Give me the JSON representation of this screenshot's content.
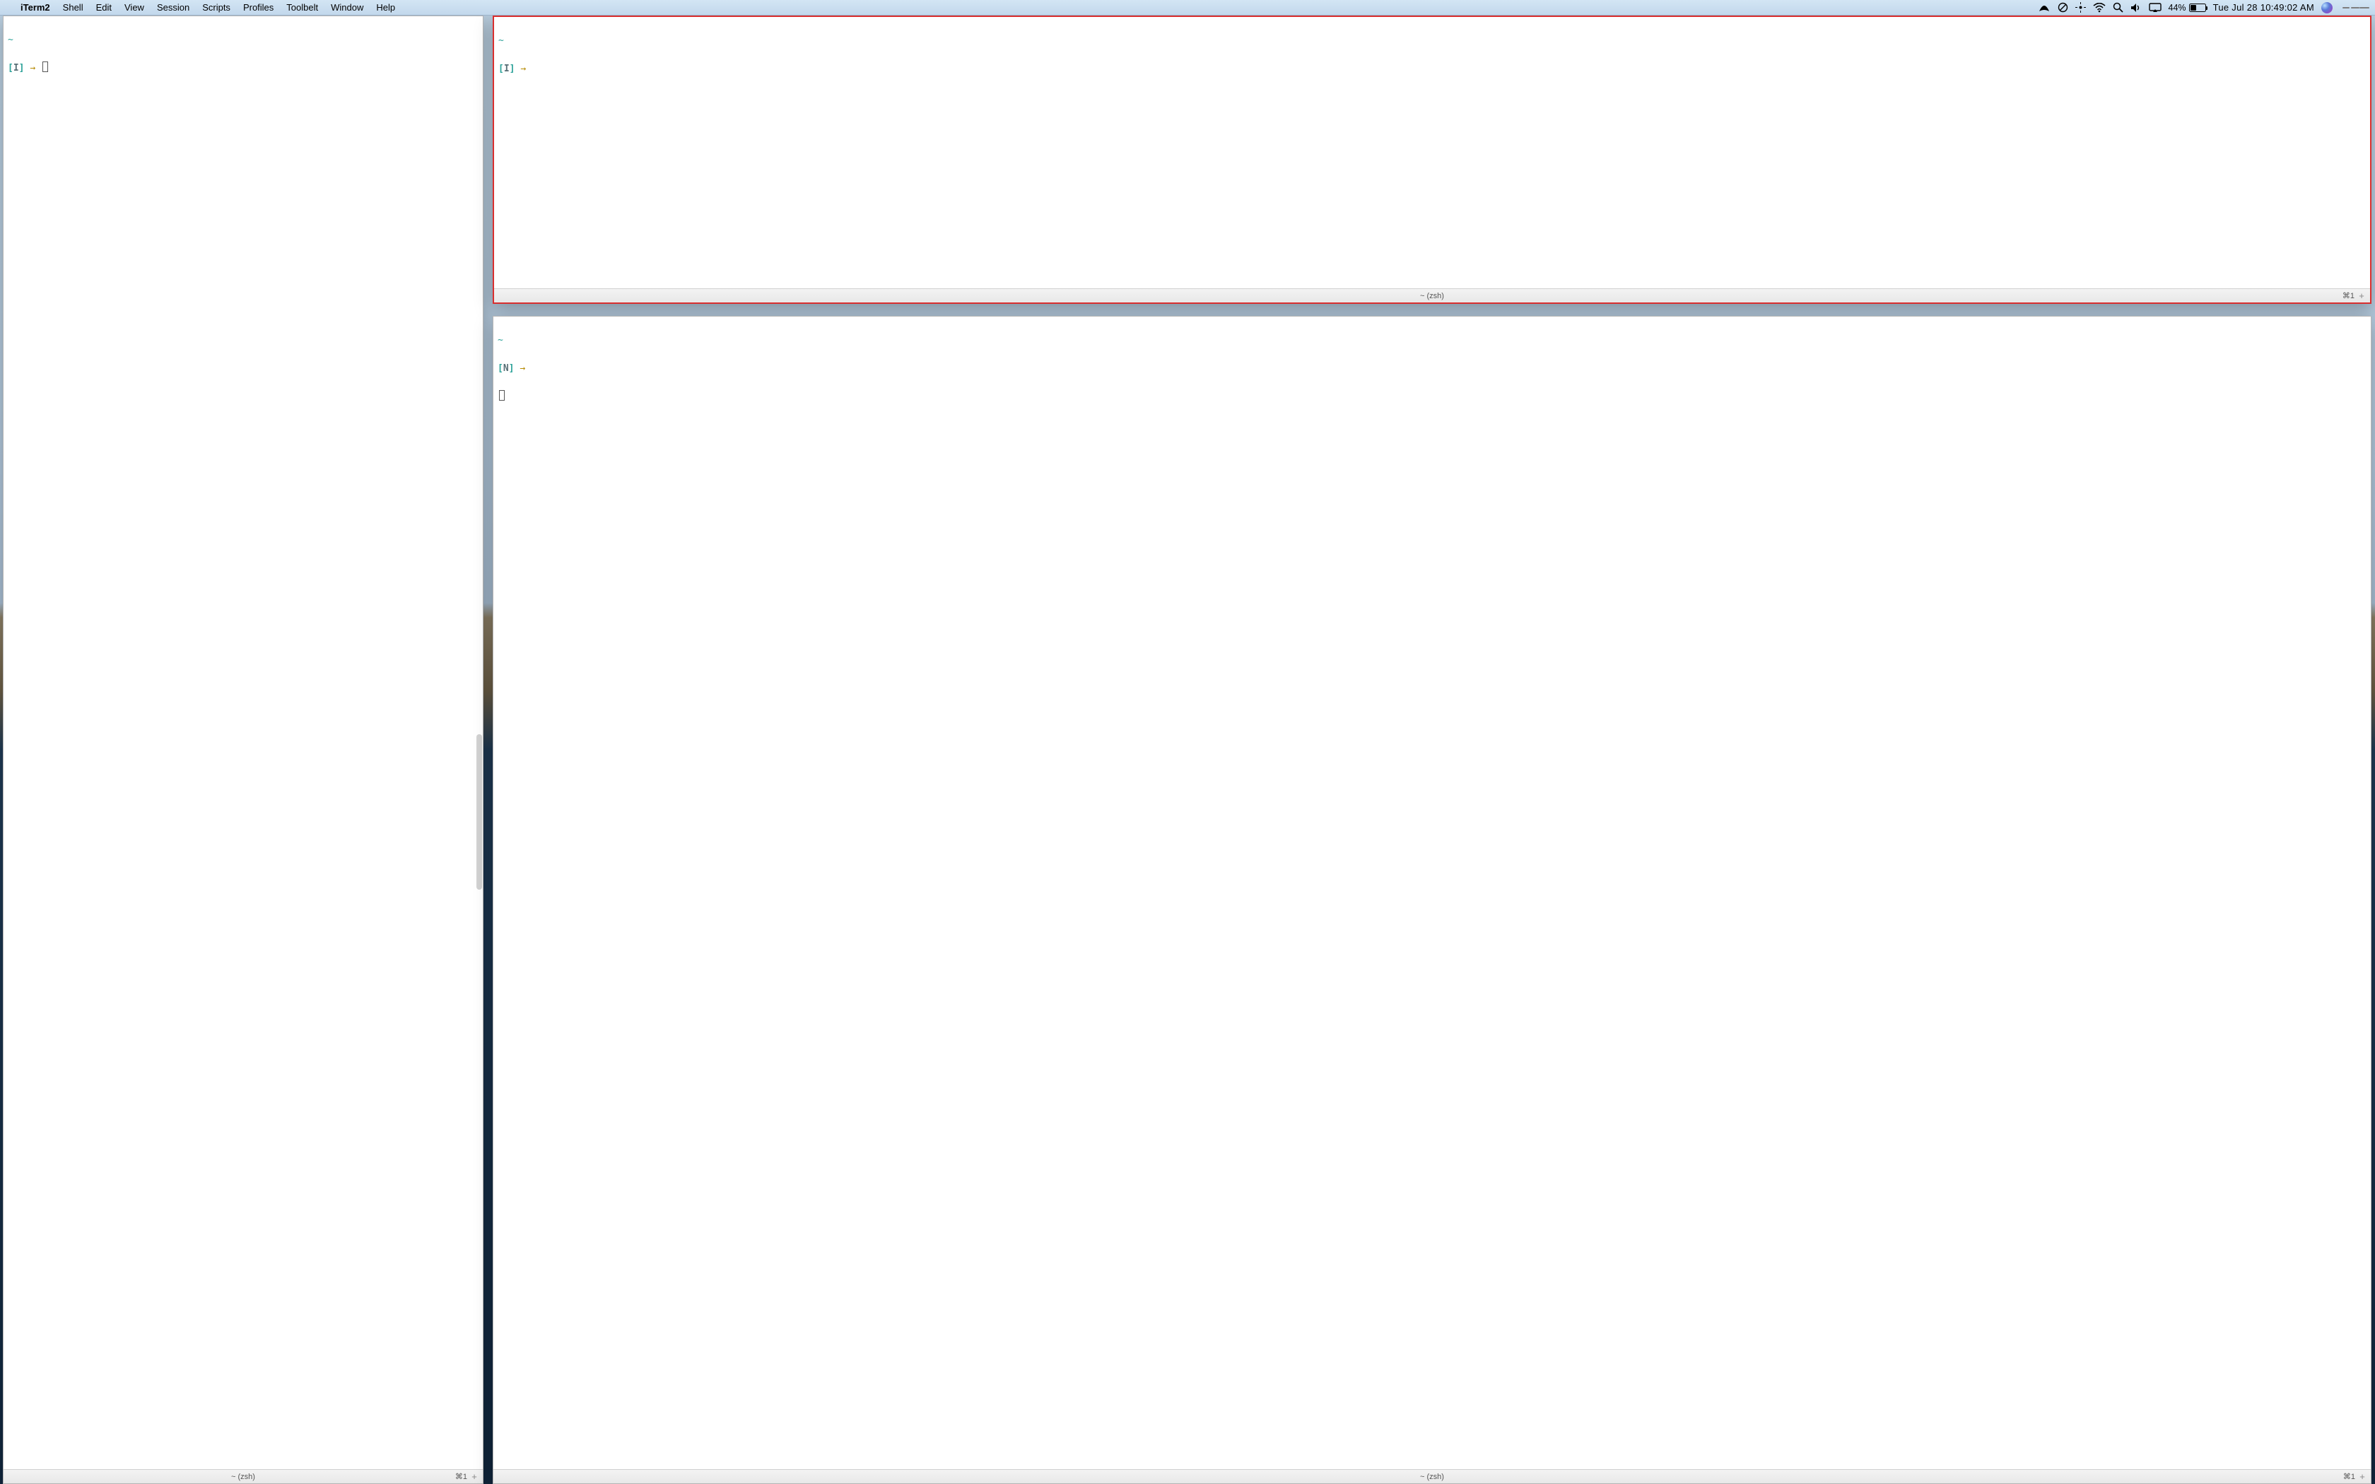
{
  "menubar": {
    "app": "iTerm2",
    "items": [
      "Shell",
      "Edit",
      "View",
      "Session",
      "Scripts",
      "Profiles",
      "Toolbelt",
      "Window",
      "Help"
    ],
    "battery_pct": "44%",
    "battery_fill_pct": 44,
    "clock": "Tue Jul 28  10:49:02 AM"
  },
  "panes": {
    "left": {
      "cwd": "~",
      "mode": "I",
      "tab_title": "~ (zsh)",
      "tab_shortcut": "⌘1"
    },
    "right_top": {
      "cwd": "~",
      "mode": "I",
      "tab_title": "~ (zsh)",
      "tab_shortcut": "⌘1"
    },
    "right_bottom": {
      "cwd": "~",
      "mode": "N",
      "tab_title": "~ (zsh)",
      "tab_shortcut": "⌘1"
    }
  },
  "glyphs": {
    "apple": "",
    "arrow": "→",
    "plus": "+"
  }
}
